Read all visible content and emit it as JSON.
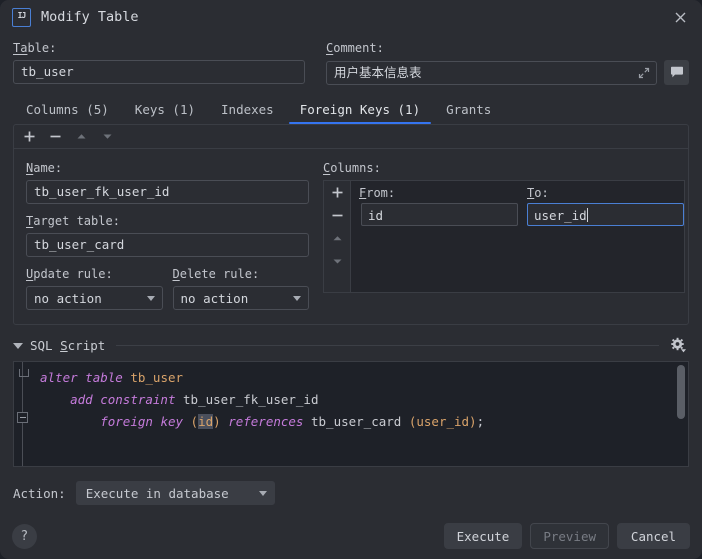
{
  "window": {
    "title": "Modify Table",
    "app_icon": "intellij-idea-icon",
    "close_icon": "close-icon"
  },
  "top": {
    "table_label": "Table:",
    "table_value": "tb_user",
    "comment_label": "Comment:",
    "comment_value": "用户基本信息表",
    "expand_icon": "expand-icon",
    "comment_button_icon": "comment-bubble-icon"
  },
  "tabs": [
    {
      "label": "Columns (5)",
      "active": false
    },
    {
      "label": "Keys (1)",
      "active": false
    },
    {
      "label": "Indexes",
      "active": false
    },
    {
      "label": "Foreign Keys (1)",
      "active": true
    },
    {
      "label": "Grants",
      "active": false
    }
  ],
  "fk_toolbar": {
    "add_icon": "plus-icon",
    "remove_icon": "minus-icon",
    "move_up_icon": "arrow-up-icon",
    "move_down_icon": "arrow-down-icon"
  },
  "fk_form": {
    "name_label": "Name:",
    "name_value": "tb_user_fk_user_id",
    "target_table_label": "Target table:",
    "target_table_value": "tb_user_card",
    "update_rule_label": "Update rule:",
    "update_rule_value": "no action",
    "delete_rule_label": "Delete rule:",
    "delete_rule_value": "no action"
  },
  "columns_panel": {
    "label": "Columns:",
    "toolbar": {
      "add_icon": "plus-icon",
      "remove_icon": "minus-icon",
      "move_up_icon": "arrow-up-icon",
      "move_down_icon": "arrow-down-icon"
    },
    "headers": {
      "from": "From:",
      "to": "To:"
    },
    "rows": [
      {
        "from": "id",
        "to": "user_id",
        "to_focused": true
      }
    ]
  },
  "sql_section": {
    "title": "SQL Script",
    "twisty_icon": "chevron-down-icon",
    "settings_icon": "gear-icon",
    "lines": [
      {
        "indent": 0,
        "tokens": [
          {
            "t": "alter",
            "c": "kw"
          },
          {
            "t": " ",
            "c": "punct"
          },
          {
            "t": "table",
            "c": "kw"
          },
          {
            "t": " ",
            "c": "punct"
          },
          {
            "t": "tb_user",
            "c": "tbl"
          }
        ]
      },
      {
        "indent": 1,
        "tokens": [
          {
            "t": "add",
            "c": "kw"
          },
          {
            "t": " ",
            "c": "punct"
          },
          {
            "t": "constraint",
            "c": "kw"
          },
          {
            "t": " ",
            "c": "punct"
          },
          {
            "t": "tb_user_fk_user_id",
            "c": "ident"
          }
        ]
      },
      {
        "indent": 2,
        "tokens": [
          {
            "t": "foreign",
            "c": "kw"
          },
          {
            "t": " ",
            "c": "punct"
          },
          {
            "t": "key",
            "c": "kw"
          },
          {
            "t": " ",
            "c": "punct"
          },
          {
            "t": "(",
            "c": "tbl"
          },
          {
            "t": "id",
            "c": "hl"
          },
          {
            "t": ")",
            "c": "tbl"
          },
          {
            "t": " ",
            "c": "punct"
          },
          {
            "t": "references",
            "c": "kw"
          },
          {
            "t": " ",
            "c": "punct"
          },
          {
            "t": "tb_user_card",
            "c": "ident"
          },
          {
            "t": " ",
            "c": "punct"
          },
          {
            "t": "(",
            "c": "tbl"
          },
          {
            "t": "user_id",
            "c": "tbl"
          },
          {
            "t": ")",
            "c": "tbl"
          },
          {
            "t": ";",
            "c": "punct"
          }
        ]
      }
    ],
    "plain_text": "alter table tb_user\n    add constraint tb_user_fk_user_id\n        foreign key (id) references tb_user_card (user_id);"
  },
  "action": {
    "label": "Action:",
    "value": "Execute in database"
  },
  "footer": {
    "help_label": "?",
    "buttons": [
      {
        "label": "Execute",
        "disabled": false
      },
      {
        "label": "Preview",
        "disabled": true
      },
      {
        "label": "Cancel",
        "disabled": false
      }
    ]
  },
  "colors": {
    "accent": "#3574f0",
    "dialog_bg": "#2b2d33",
    "editor_bg": "#1e2128",
    "keyword": "#c57bdb",
    "table_token": "#d9a36a",
    "focus_border": "#4a7fd4"
  }
}
